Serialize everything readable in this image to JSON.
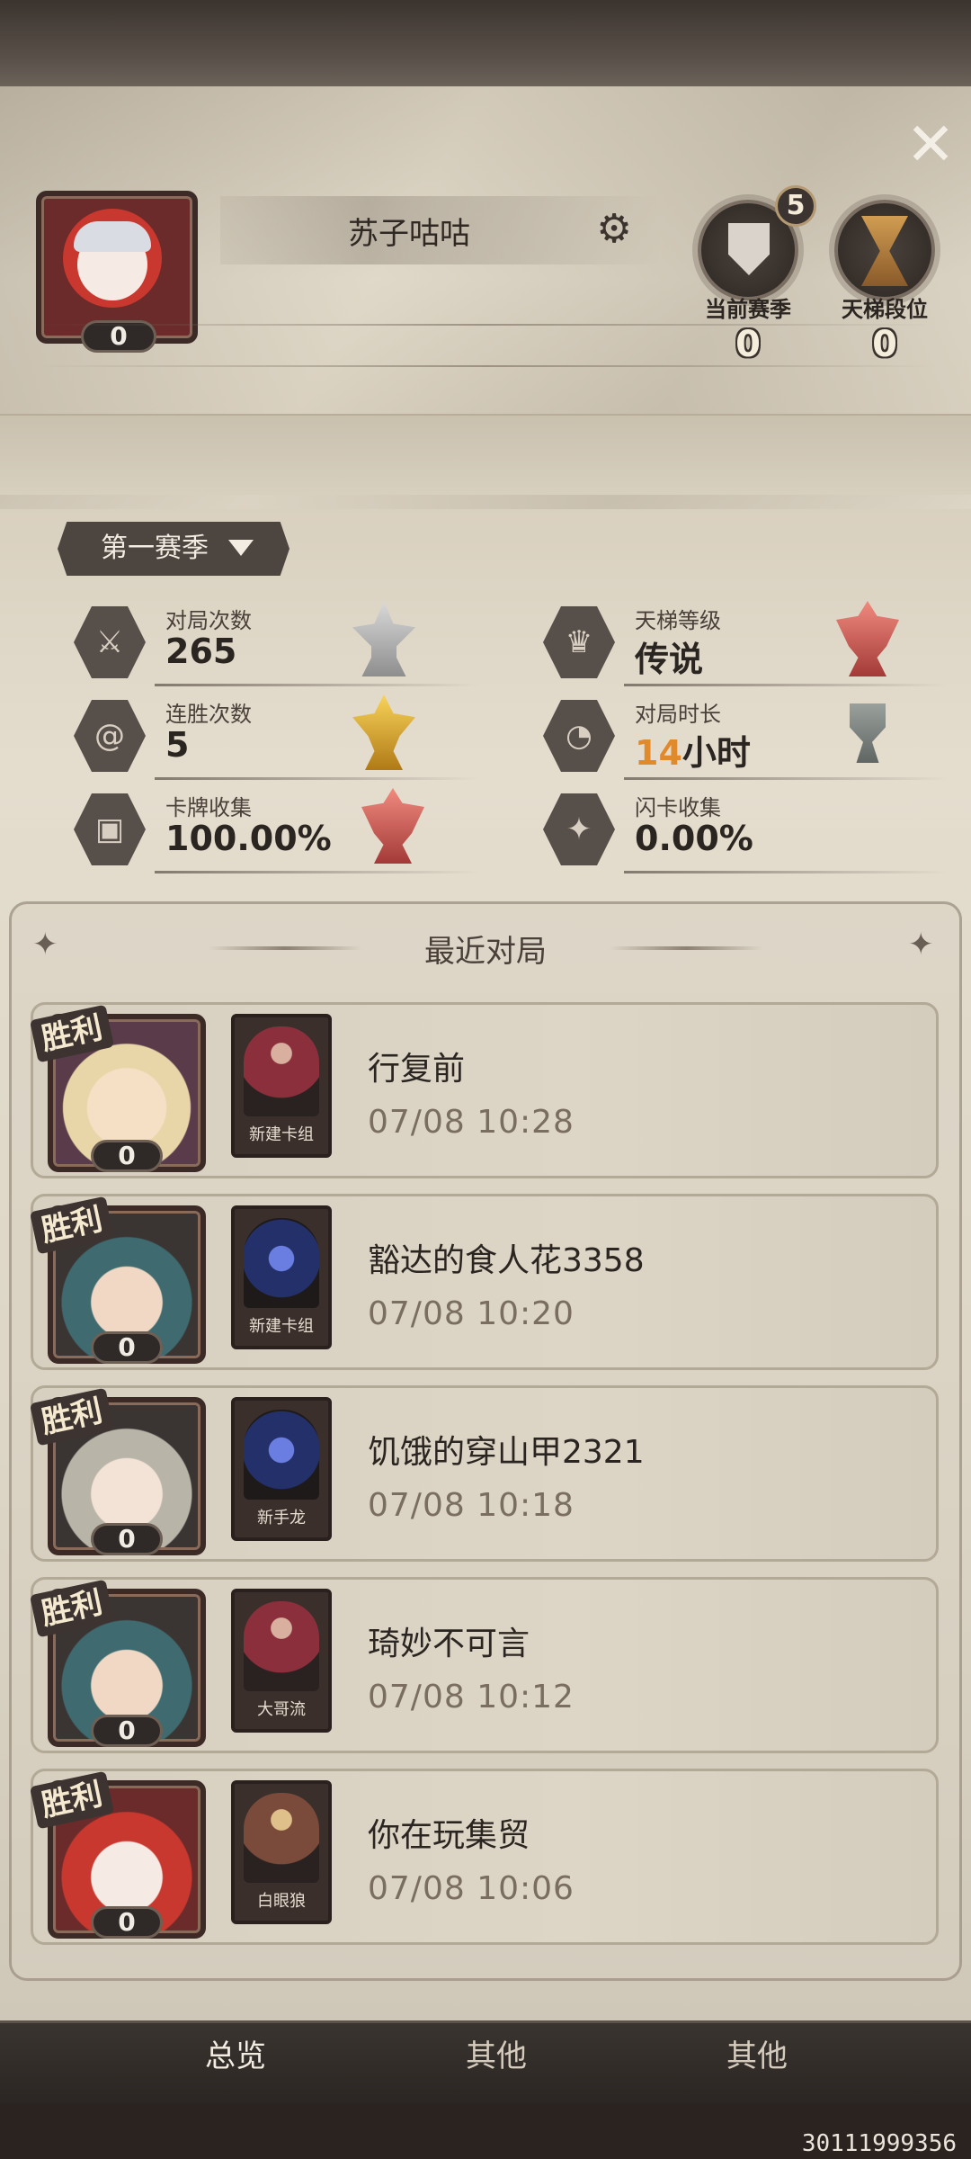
{
  "profile": {
    "name": "苏子咕咕",
    "level": "0",
    "season_badge": "5",
    "emblems": [
      {
        "label": "当前赛季",
        "value": "0"
      },
      {
        "label": "天梯段位",
        "value": "0"
      }
    ]
  },
  "season_selector": {
    "label": "第一赛季"
  },
  "stats": [
    {
      "label": "对局次数",
      "value": "265"
    },
    {
      "label": "天梯等级",
      "value": "传说"
    },
    {
      "label": "连胜次数",
      "value": "5"
    },
    {
      "label": "对局时长",
      "value_num": "14",
      "value_unit": "小时"
    },
    {
      "label": "卡牌收集",
      "value": "100.00%"
    },
    {
      "label": "闪卡收集",
      "value": "0.00%"
    }
  ],
  "recent": {
    "title": "最近对局",
    "matches": [
      {
        "result": "胜利",
        "level": "0",
        "deck": "新建卡组",
        "opponent": "行复前",
        "time": "07/08 10:28"
      },
      {
        "result": "胜利",
        "level": "0",
        "deck": "新建卡组",
        "opponent": "豁达的食人花3358",
        "time": "07/08 10:20"
      },
      {
        "result": "胜利",
        "level": "0",
        "deck": "新手龙",
        "opponent": "饥饿的穿山甲2321",
        "time": "07/08 10:18"
      },
      {
        "result": "胜利",
        "level": "0",
        "deck": "大哥流",
        "opponent": "琦妙不可言",
        "time": "07/08 10:12"
      },
      {
        "result": "胜利",
        "level": "0",
        "deck": "白眼狼",
        "opponent": "你在玩集贸",
        "time": "07/08 10:06"
      }
    ]
  },
  "tabs": [
    "总览",
    "其他",
    "其他"
  ],
  "uid": "30111999356",
  "colors": {
    "highlight": "#e08a2c",
    "panel": "#ddd6c6",
    "frame": "#3b2a25"
  }
}
